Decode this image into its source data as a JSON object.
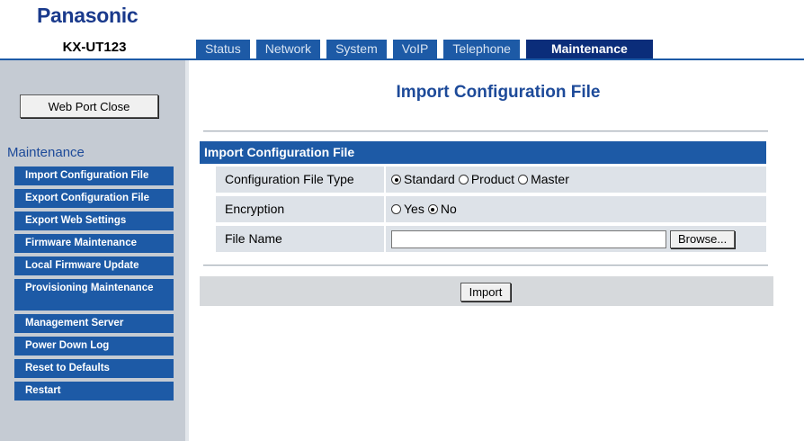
{
  "brand": "Panasonic",
  "model": "KX-UT123",
  "tabs": [
    {
      "label": "Status"
    },
    {
      "label": "Network"
    },
    {
      "label": "System"
    },
    {
      "label": "VoIP"
    },
    {
      "label": "Telephone"
    },
    {
      "label": "Maintenance",
      "active": true
    }
  ],
  "sidebar": {
    "web_port_close": "Web Port Close",
    "section_title": "Maintenance",
    "items": [
      {
        "label": "Import Configuration File"
      },
      {
        "label": "Export Configuration File"
      },
      {
        "label": "Export Web Settings"
      },
      {
        "label": "Firmware Maintenance"
      },
      {
        "label": "Local Firmware Update"
      },
      {
        "label": "Provisioning Maintenance"
      },
      {
        "label": "Management Server"
      },
      {
        "label": "Power Down Log"
      },
      {
        "label": "Reset to Defaults"
      },
      {
        "label": "Restart"
      }
    ]
  },
  "main": {
    "page_title": "Import Configuration File",
    "section_header": "Import Configuration File",
    "config_type": {
      "label": "Configuration File Type",
      "options": [
        "Standard",
        "Product",
        "Master"
      ],
      "selected": "Standard"
    },
    "encryption": {
      "label": "Encryption",
      "options": [
        "Yes",
        "No"
      ],
      "selected": "No"
    },
    "file_name": {
      "label": "File Name",
      "value": "",
      "browse_label": "Browse..."
    },
    "import_label": "Import"
  },
  "colors": {
    "tab_blue": "#1d5aa6",
    "tab_active": "#0b2d7a",
    "title_blue": "#1d4a99",
    "sidebar_bg": "#c5cbd3",
    "row_bg": "#dde2e8"
  }
}
